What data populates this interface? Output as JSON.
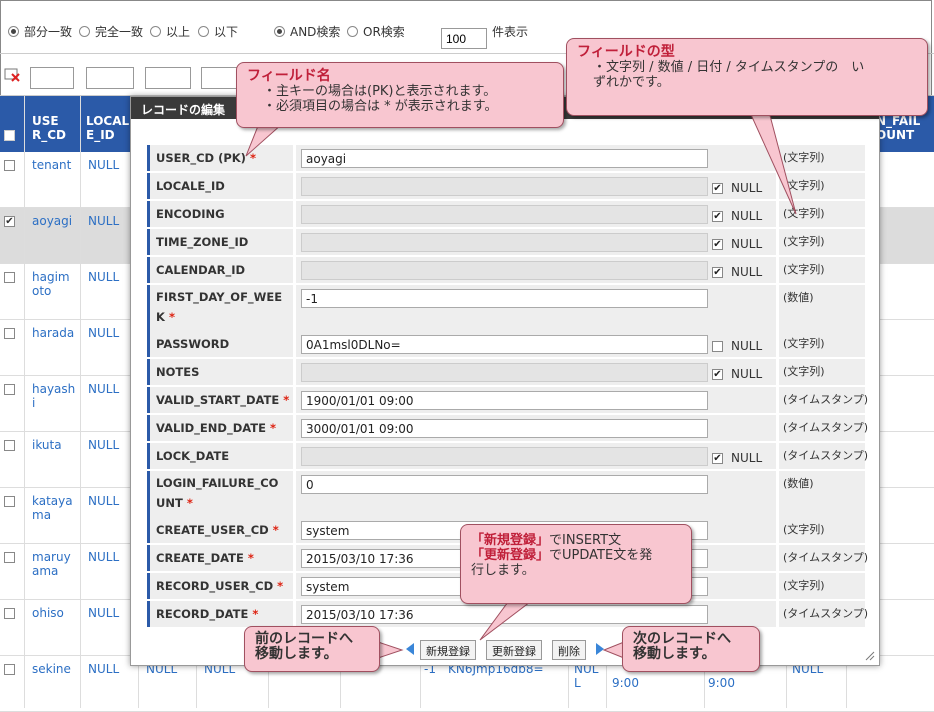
{
  "search_options": {
    "match_partial": "部分一致",
    "match_exact": "完全一致",
    "gte": "以上",
    "lte": "以下",
    "and_search": "AND検索",
    "or_search": "OR検索",
    "count_value": "100",
    "count_suffix": "件表示"
  },
  "table": {
    "headers": {
      "user_cd": "USE R_CD",
      "locale_id": "LOCAL E_ID",
      "login_fail": "N_FAIL OUNT"
    },
    "rows": [
      {
        "user_cd": "tenant",
        "locale": "NULL",
        "checked": false
      },
      {
        "user_cd": "aoyagi",
        "locale": "NULL",
        "checked": true
      },
      {
        "user_cd": "hagimoto",
        "locale": "NULL",
        "checked": false
      },
      {
        "user_cd": "harada",
        "locale": "NULL",
        "checked": false
      },
      {
        "user_cd": "hayashi",
        "locale": "NULL",
        "checked": false
      },
      {
        "user_cd": "ikuta",
        "locale": "NULL",
        "checked": false
      },
      {
        "user_cd": "katayama",
        "locale": "NULL",
        "checked": false
      },
      {
        "user_cd": "maruyama",
        "locale": "NULL",
        "checked": false
      },
      {
        "user_cd": "ohiso",
        "locale": "NULL",
        "checked": false
      },
      {
        "user_cd": "sekine",
        "locale": "NULL",
        "checked": false
      }
    ],
    "last_row_cells": {
      "c1": "NULL",
      "c2": "NULL",
      "c3": "-1",
      "c4": "KN6Jmp16db8=",
      "c5a": "NUL",
      "c5b": "L",
      "c6": "9:00",
      "c7": "9:00",
      "c8": "NULL"
    }
  },
  "dialog": {
    "title": "レコードの編集",
    "null_label": "NULL",
    "fields": [
      {
        "label": "USER_CD (PK)",
        "value": "aoyagi",
        "type": "(文字列)"
      },
      {
        "label": "LOCALE_ID",
        "value": "",
        "type": "(文字列)"
      },
      {
        "label": "ENCODING",
        "value": "",
        "type": "(文字列)"
      },
      {
        "label": "TIME_ZONE_ID",
        "value": "",
        "type": "(文字列)"
      },
      {
        "label": "CALENDAR_ID",
        "value": "",
        "type": "(文字列)"
      },
      {
        "label": "FIRST_DAY_OF_WEEK",
        "value": "-1",
        "type": "(数値)"
      },
      {
        "label": "PASSWORD",
        "value": "0A1msl0DLNo=",
        "type": "(文字列)"
      },
      {
        "label": "NOTES",
        "value": "",
        "type": "(文字列)"
      },
      {
        "label": "VALID_START_DATE",
        "value": "1900/01/01 09:00",
        "type": "(タイムスタンプ)"
      },
      {
        "label": "VALID_END_DATE",
        "value": "3000/01/01 09:00",
        "type": "(タイムスタンプ)"
      },
      {
        "label": "LOCK_DATE",
        "value": "",
        "type": "(タイムスタンプ)"
      },
      {
        "label": "LOGIN_FAILURE_COUNT",
        "value": "0",
        "type": "(数値)"
      },
      {
        "label": "CREATE_USER_CD",
        "value": "system",
        "type": "(文字列)"
      },
      {
        "label": "CREATE_DATE",
        "value": "2015/03/10 17:36",
        "type": "(タイムスタンプ)"
      },
      {
        "label": "RECORD_USER_CD",
        "value": "system",
        "type": "(文字列)"
      },
      {
        "label": "RECORD_DATE",
        "value": "2015/03/10 17:36",
        "type": "(タイムスタンプ)"
      }
    ],
    "buttons": {
      "insert": "新規登録",
      "update": "更新登録",
      "delete": "削除"
    }
  },
  "callouts": {
    "field_name": {
      "title": "フィールド名",
      "line1": "・主キーの場合は(PK)と表示されます。",
      "line2": "・必須項目の場合は * が表示されます。"
    },
    "field_type": {
      "title": "フィールドの型",
      "line1": "・文字列 / 数値 / 日付 / タイムスタンプの　い",
      "line2": "ずれかです。"
    },
    "buttons": {
      "insert_label": "「新規登録」",
      "insert_text": "でINSERT文",
      "update_label": "「更新登録」",
      "update_text": "でUPDATE文を発",
      "line3": "行します。"
    },
    "prev": {
      "line1": "前のレコードへ",
      "line2": "移動します。"
    },
    "next": {
      "line1": "次のレコードへ",
      "line2": "移動します。"
    }
  },
  "colors": {
    "header_blue": "#2b5aa8",
    "callout_pink": "#f8c6d0",
    "callout_red": "#c0203a"
  }
}
